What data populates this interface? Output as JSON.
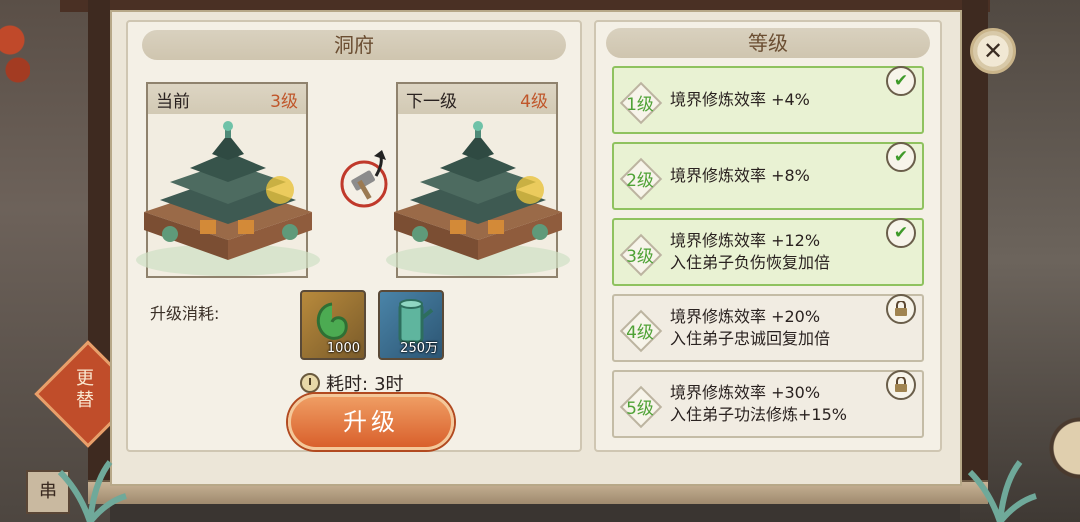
{
  "left_panel": {
    "title": "洞府",
    "current": {
      "label": "当前",
      "level": "3级"
    },
    "next": {
      "label": "下一级",
      "level": "4级"
    },
    "cost_label": "升级消耗:",
    "items": [
      {
        "icon": "jade-icon",
        "count": "1000"
      },
      {
        "icon": "wood-log-icon",
        "count": "250万"
      }
    ],
    "time_label": "耗时:",
    "time_value": "3时",
    "upgrade_label": "升级"
  },
  "right_panel": {
    "title": "等级",
    "levels": [
      {
        "level": "1级",
        "lines": [
          "境界修炼效率 +4%"
        ],
        "status": "unlocked"
      },
      {
        "level": "2级",
        "lines": [
          "境界修炼效率 +8%"
        ],
        "status": "unlocked"
      },
      {
        "level": "3级",
        "lines": [
          "境界修炼效率 +12%",
          "入住弟子负伤恢复加倍"
        ],
        "status": "unlocked"
      },
      {
        "level": "4级",
        "lines": [
          "境界修炼效率 +20%",
          "入住弟子忠诚回复加倍"
        ],
        "status": "locked"
      },
      {
        "level": "5级",
        "lines": [
          "境界修炼效率 +30%",
          "入住弟子功法修炼+15%"
        ],
        "status": "locked"
      }
    ]
  },
  "side": {
    "button_label": "更替",
    "tab_label": "串"
  },
  "colors": {
    "accent": "#d9602c",
    "unlocked_green": "#8fc25f",
    "panel": "#ece6d8"
  }
}
